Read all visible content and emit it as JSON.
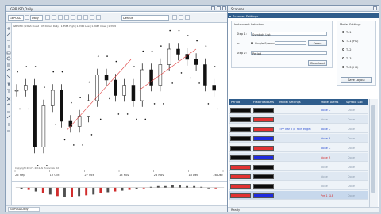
{
  "chart_window": {
    "title": "GBPUSD,Daily",
    "toolbar": {
      "symbol": "GBPUSD",
      "timeframe": "Daily",
      "template": "Default"
    },
    "info_text": "GBPUSD (British Pound / US Dollar) Daily | 1.3565 High | 1.3340 Low | 1.3467 Close | 1.3385",
    "watermark": "Copyright 2017 - 2019 AI Financials Ltd",
    "x_labels": [
      "26 Sep",
      "12 Oct",
      "27 Oct",
      "13 Nov",
      "28 Nov",
      "13 Dec",
      "28 Dec"
    ],
    "tab_label": "GBPUSD,Daily"
  },
  "scanner_window": {
    "title": "Scanner",
    "settings_label": "Scanner Settings",
    "instrument_group_label": "Instrument Selection",
    "step1_label": "Step 1:",
    "step1_field": "Symbols List",
    "or_label": "or",
    "single_symbol_label": "Single Symbol",
    "select_button": "Select",
    "step2_label": "Step 2:",
    "step2_field": "Period",
    "download_button": "Download",
    "model_group_label": "Model Settings",
    "model_options": [
      "TL1",
      "TL1 (HS)",
      "TL2",
      "TL3",
      "TL3 (HS)"
    ],
    "save_button": "Save Layout",
    "columns": [
      "Period",
      "Historical Bars",
      "Model Settings",
      "Model Alerts",
      "Symbol List"
    ],
    "status_text": "Ready"
  },
  "rows": [
    {
      "c1": "#0c0c0c",
      "c2": "#0c0c0c",
      "model": "",
      "alert": "None C",
      "alert_style": "cell-blue",
      "sym": "Done"
    },
    {
      "c1": "#0c0c0c",
      "c2": "#e23232",
      "model": "",
      "alert": "None",
      "alert_style": "cell-grey",
      "sym": "Done"
    },
    {
      "c1": "#0c0c0c",
      "c2": "#e23232",
      "model": "TPP Bar 2 (T falls edge)",
      "alert": "None C",
      "alert_style": "cell-blue",
      "sym": "Done"
    },
    {
      "c1": "#0c0c0c",
      "c2": "#1f2ce0",
      "model": "",
      "alert": "None R",
      "alert_style": "cell-blue",
      "sym": "Done"
    },
    {
      "c1": "#0c0c0c",
      "c2": "#e23232",
      "model": "",
      "alert": "None C",
      "alert_style": "cell-blue",
      "sym": "Done"
    },
    {
      "c1": "#0c0c0c",
      "c2": "#1f2ce0",
      "model": "",
      "alert": "None R",
      "alert_style": "cell-red",
      "sym": "Done"
    },
    {
      "c1": "#e23232",
      "c2": "#0c0c0c",
      "model": "",
      "alert": "None",
      "alert_style": "cell-grey",
      "sym": "Done"
    },
    {
      "c1": "#e23232",
      "c2": "#0c0c0c",
      "model": "",
      "alert": "None",
      "alert_style": "cell-grey",
      "sym": "Done"
    },
    {
      "c1": "#e23232",
      "c2": "#0c0c0c",
      "model": "",
      "alert": "None",
      "alert_style": "cell-grey",
      "sym": "Done"
    },
    {
      "c1": "#e23232",
      "c2": "#1f2ce0",
      "model": "",
      "alert": "Pre 1 SLB",
      "alert_style": "cell-red",
      "sym": "Done"
    }
  ],
  "chart_data": {
    "type": "candlestick",
    "title": "",
    "xlabel": "",
    "ylabel": "",
    "categories": [
      "26 Sep",
      "12 Oct",
      "27 Oct",
      "13 Nov",
      "28 Nov",
      "13 Dec",
      "28 Dec"
    ],
    "close_approx": [
      1.3,
      1.305,
      1.245,
      1.285,
      1.3,
      1.27,
      1.265,
      1.275,
      1.29,
      1.315,
      1.31,
      1.295,
      1.305,
      1.29,
      1.32,
      1.305,
      1.325,
      1.34,
      1.335,
      1.33,
      1.325,
      1.305,
      1.3
    ]
  }
}
